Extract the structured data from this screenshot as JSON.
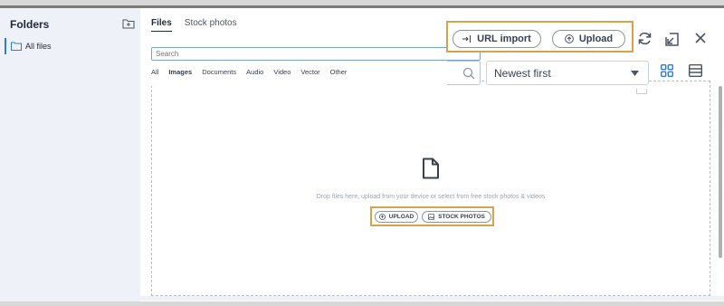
{
  "sidebar": {
    "title": "Folders",
    "items": [
      {
        "label": "All files",
        "active": true
      }
    ]
  },
  "tabs": [
    {
      "label": "Files",
      "active": true
    },
    {
      "label": "Stock photos",
      "active": false
    }
  ],
  "search": {
    "placeholder": "Search"
  },
  "filters": [
    {
      "label": "All",
      "active": false
    },
    {
      "label": "Images",
      "active": true
    },
    {
      "label": "Documents",
      "active": false
    },
    {
      "label": "Audio",
      "active": false
    },
    {
      "label": "Video",
      "active": false
    },
    {
      "label": "Vector",
      "active": false
    },
    {
      "label": "Other",
      "active": false
    }
  ],
  "actions": {
    "url_import": "URL import",
    "upload": "Upload"
  },
  "sort": {
    "selected": "Newest first"
  },
  "dropzone": {
    "text": "Drop files here, upload from your device or select from free stock photos & videos",
    "upload_label": "UPLOAD",
    "stock_label": "STOCK PHOTOS"
  },
  "colors": {
    "accent": "#2d7dd2",
    "highlight": "#d6a24a",
    "sidebar_bg": "#eef1f7"
  }
}
